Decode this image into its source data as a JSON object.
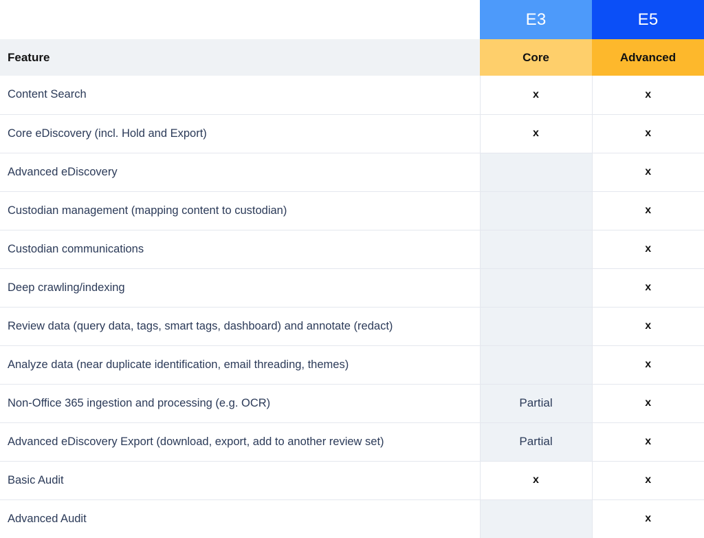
{
  "table": {
    "feature_column_header": "Feature",
    "plans": [
      {
        "name": "E3",
        "tier": "Core",
        "name_bg": "#4d9afa",
        "tier_bg": "#fecf6b"
      },
      {
        "name": "E5",
        "tier": "Advanced",
        "name_bg": "#0b4ff7",
        "tier_bg": "#fdb82c"
      }
    ],
    "marks": {
      "included": "x",
      "partial": "Partial",
      "none": ""
    },
    "colors": {
      "feature_header_bg": "#eff2f5",
      "empty_cell_bg": "#eef2f6",
      "row_divider": "#e4e7ee",
      "feature_text": "#2b3a58",
      "header_text": "#121212"
    },
    "rows": [
      {
        "feature": "Content Search",
        "e3": "x",
        "e5": "x"
      },
      {
        "feature": "Core eDiscovery (incl. Hold and Export)",
        "e3": "x",
        "e5": "x"
      },
      {
        "feature": "Advanced eDiscovery",
        "e3": "",
        "e5": "x"
      },
      {
        "feature": "Custodian management (mapping content to custodian)",
        "e3": "",
        "e5": "x"
      },
      {
        "feature": "Custodian communications",
        "e3": "",
        "e5": "x"
      },
      {
        "feature": "Deep crawling/indexing",
        "e3": "",
        "e5": "x"
      },
      {
        "feature": "Review data (query data, tags, smart tags, dashboard) and annotate (redact)",
        "e3": "",
        "e5": "x"
      },
      {
        "feature": "Analyze data (near duplicate identification, email threading, themes)",
        "e3": "",
        "e5": "x"
      },
      {
        "feature": "Non-Office 365 ingestion and processing (e.g. OCR)",
        "e3": "Partial",
        "e5": "x"
      },
      {
        "feature": "Advanced eDiscovery Export (download, export, add to another review set)",
        "e3": "Partial",
        "e5": "x"
      },
      {
        "feature": "Basic Audit",
        "e3": "x",
        "e5": "x"
      },
      {
        "feature": "Advanced Audit",
        "e3": "",
        "e5": "x"
      }
    ]
  }
}
